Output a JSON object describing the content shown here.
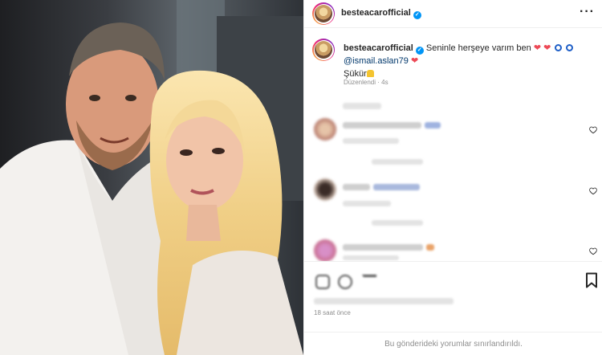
{
  "post": {
    "username": "besteacarofficial",
    "verified_icon": "verified-badge-icon",
    "more_icon": "more-options-icon"
  },
  "caption": {
    "username": "besteacarofficial",
    "text": "Seninle herşeye varım ben",
    "mention": "@ismail.aslan79",
    "line3": "Şükür",
    "edited": "Düzenlendi",
    "edited_time": "4s"
  },
  "comments": [
    {
      "like_icon": "heart-outline-icon"
    },
    {
      "like_icon": "heart-outline-icon"
    },
    {
      "like_icon": "heart-outline-icon"
    }
  ],
  "actions": {
    "save_icon": "bookmark-icon",
    "time": "18 saat önce"
  },
  "footer": {
    "text": "Bu gönderideki yorumlar sınırlandırıldı."
  },
  "colors": {
    "verified": "#0095f6",
    "heart": "#ed4956",
    "mention": "#00376b"
  }
}
